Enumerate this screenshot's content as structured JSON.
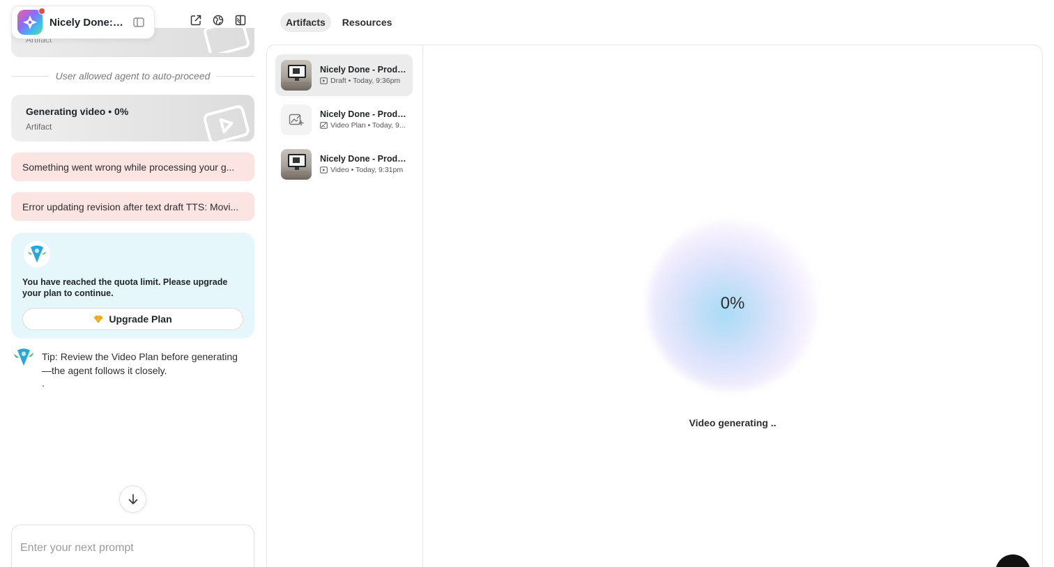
{
  "project": {
    "title": "Nicely Done: Product Demo"
  },
  "chat": {
    "partial_card_subtitle": "Artifact",
    "divider_text": "User allowed agent to auto-proceed",
    "generating_card": {
      "title": "Generating video • 0%",
      "subtitle": "Artifact"
    },
    "errors": [
      "Something went wrong while processing your g...",
      "Error updating revision after text draft TTS: Movi..."
    ],
    "quota": {
      "message": "You have reached the quota limit. Please upgrade your plan to continue.",
      "button_label": "Upgrade Plan"
    },
    "tip": {
      "text": "Tip: Review the Video Plan before generating—the agent follows it closely.",
      "trailing": "."
    },
    "prompt_placeholder": "Enter your next prompt"
  },
  "tabs": [
    {
      "label": "Artifacts",
      "active": true
    },
    {
      "label": "Resources",
      "active": false
    }
  ],
  "artifacts": [
    {
      "name": "Nicely Done - Product Demo",
      "type": "Draft",
      "time": "Today, 9:36pm",
      "meta": "Draft • Today, 9:36pm",
      "icon": "video-icon",
      "thumb": "photo",
      "selected": true
    },
    {
      "name": "Nicely Done - Product Demo",
      "type": "Video Plan",
      "time": "Today, 9...",
      "meta": "Video Plan • Today, 9...",
      "icon": "edit-image-icon",
      "thumb": "plan",
      "selected": false
    },
    {
      "name": "Nicely Done - Product Demo",
      "type": "Video",
      "time": "Today, 9:31pm",
      "meta": "Video • Today, 9:31pm",
      "icon": "video-icon",
      "thumb": "photo",
      "selected": false
    }
  ],
  "preview": {
    "progress": "0%",
    "status": "Video generating .."
  },
  "colors": {
    "error_bg": "#fbe4e2",
    "quota_bg": "#e6f7fb",
    "tab_active_bg": "#ececec"
  }
}
